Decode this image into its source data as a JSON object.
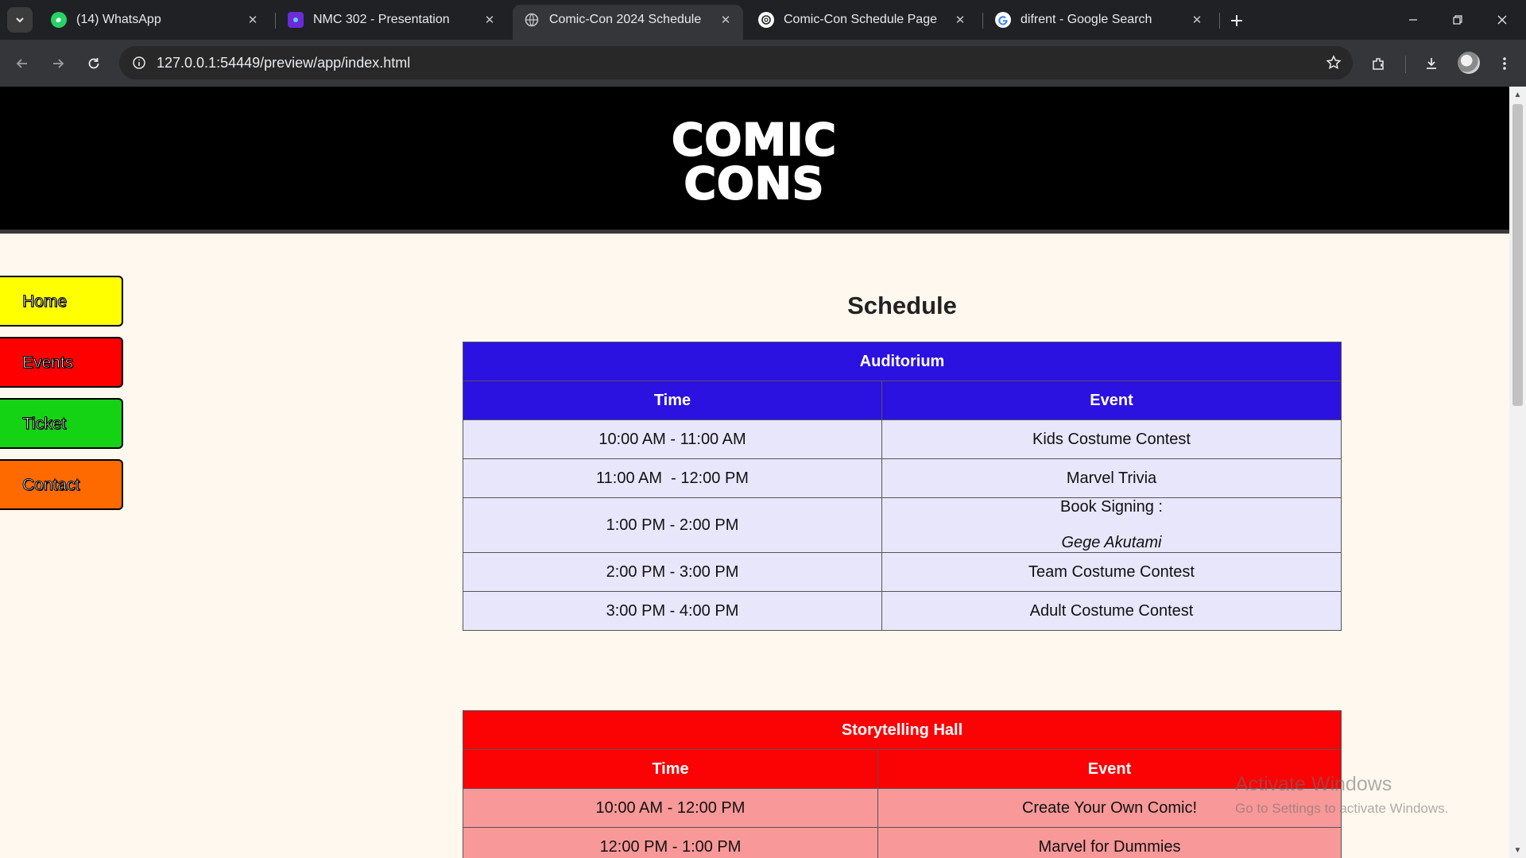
{
  "browser": {
    "tabs": [
      {
        "title": "(14) WhatsApp",
        "favicon": "whatsapp-icon",
        "active": false
      },
      {
        "title": "NMC 302 - Presentation",
        "favicon": "presentation-icon",
        "active": false
      },
      {
        "title": "Comic-Con 2024 Schedule",
        "favicon": "globe-icon",
        "active": true
      },
      {
        "title": "Comic-Con Schedule Page",
        "favicon": "openai-icon",
        "active": false
      },
      {
        "title": "difrent - Google Search",
        "favicon": "google-icon",
        "active": false
      }
    ],
    "url": "127.0.0.1:54449/preview/app/index.html"
  },
  "site": {
    "logo_line1": "COMIC",
    "logo_line2": "CONS",
    "nav": [
      {
        "label": "Home",
        "color": "#ffff00"
      },
      {
        "label": "Events",
        "color": "#ff0000"
      },
      {
        "label": "Ticket",
        "color": "#14d214"
      },
      {
        "label": "Contact",
        "color": "#ff6a00"
      }
    ],
    "title": "Schedule",
    "auditorium": {
      "name": "Auditorium",
      "col_time": "Time",
      "col_event": "Event",
      "rows": [
        {
          "time": "10:00 AM - 11:00 AM",
          "event": "Kids Costume Contest"
        },
        {
          "time": "11:00 AM  - 12:00 PM",
          "event": "Marvel Trivia"
        },
        {
          "time": "1:00 PM - 2:00 PM",
          "event": "Book Signing :",
          "guest": "Gege Akutami"
        },
        {
          "time": "2:00 PM - 3:00 PM",
          "event": "Team Costume Contest"
        },
        {
          "time": "3:00 PM - 4:00 PM",
          "event": "Adult Costume Contest"
        }
      ]
    },
    "storytelling": {
      "name": "Storytelling Hall",
      "col_time": "Time",
      "col_event": "Event",
      "rows": [
        {
          "time": "10:00 AM - 12:00 PM",
          "event": "Create Your Own Comic!"
        },
        {
          "time": "12:00 PM - 1:00 PM",
          "event": "Marvel for Dummies"
        }
      ]
    }
  },
  "watermark": {
    "line1": "Activate Windows",
    "line2": "Go to Settings to activate Windows."
  },
  "colors": {
    "auditorium_header": "#2b12e0",
    "storytelling_header": "#fb0204"
  }
}
